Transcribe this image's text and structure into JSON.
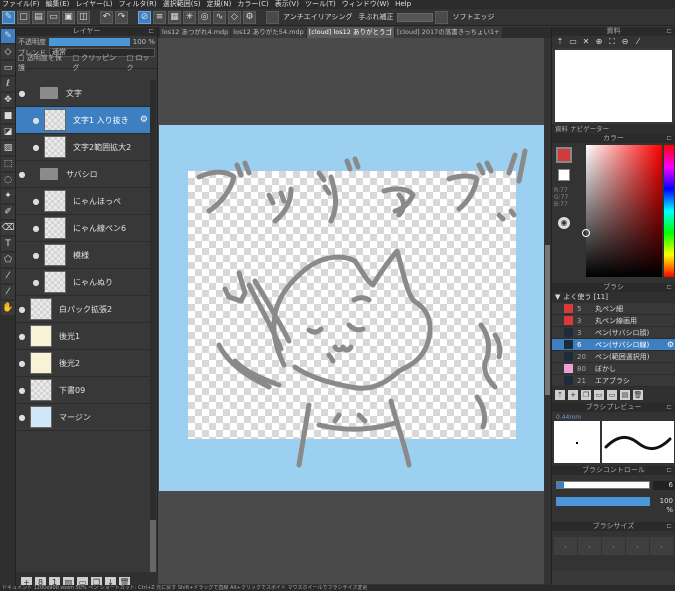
{
  "menu": [
    "ファイル(F)",
    "編集(E)",
    "レイヤー(L)",
    "フィルタ(R)",
    "選択範囲(S)",
    "定規(N)",
    "カラー(C)",
    "表示(V)",
    "ツール(T)",
    "ウィンドウ(W)",
    "Help"
  ],
  "toolbar": {
    "antialias_label": "アンチエイリアシング",
    "stabilizer_label": "手ぶれ補正",
    "soft_edge_label": "ソフトエッジ"
  },
  "layer_panel": {
    "title": "レイヤー",
    "opacity_label": "不透明度",
    "opacity_value": "100 %",
    "opacity_fraction": 1.0,
    "blend_label": "ブレンド",
    "blend_value": "通常",
    "protect_alpha_label": "透明度を保護",
    "clipping_label": "クリッピング",
    "lock_label": "ロック",
    "layers": [
      {
        "name": "文字",
        "type": "folder",
        "indent": false,
        "selected": false
      },
      {
        "name": "文字1 入り抜き",
        "type": "layer",
        "indent": true,
        "selected": true
      },
      {
        "name": "文字2範囲拡大2",
        "type": "layer",
        "indent": true,
        "selected": false
      },
      {
        "name": "サバシロ",
        "type": "folder",
        "indent": false,
        "selected": false
      },
      {
        "name": "にゃんほっぺ",
        "type": "layer",
        "indent": true,
        "selected": false
      },
      {
        "name": "にゃん線ペン6",
        "type": "layer",
        "indent": true,
        "selected": false
      },
      {
        "name": "模様",
        "type": "layer",
        "indent": true,
        "selected": false
      },
      {
        "name": "にゃんぬり",
        "type": "layer",
        "indent": true,
        "selected": false
      },
      {
        "name": "白パック拡張2",
        "type": "layer",
        "indent": false,
        "selected": false
      },
      {
        "name": "後光1",
        "type": "layer",
        "indent": false,
        "selected": false
      },
      {
        "name": "後光2",
        "type": "layer",
        "indent": false,
        "selected": false
      },
      {
        "name": "下書09",
        "type": "layer",
        "indent": false,
        "selected": false
      },
      {
        "name": "マージン",
        "type": "layer",
        "indent": false,
        "selected": false
      }
    ]
  },
  "tabs": [
    {
      "label": "los12 あつがれ4.mdp",
      "active": false
    },
    {
      "label": "los12 ありがた54.mdp",
      "active": false
    },
    {
      "label": "[cloud] los12 ありがとうゴ",
      "active": true
    },
    {
      "label": "[cloud] 2017の落書きっちょい1+",
      "active": false
    }
  ],
  "materials": {
    "title": "資料",
    "navigator_tab": "資料  ナビゲーター"
  },
  "color": {
    "title": "カラー",
    "main": "#d03b3b",
    "sub": "#ffffff",
    "readout": [
      "R:77",
      "G:77",
      "B:77"
    ]
  },
  "brush": {
    "title": "ブラシ",
    "group": "よく使う [11]",
    "items": [
      {
        "size": "5",
        "name": "丸ペン細",
        "color": "#d83a3a",
        "selected": false
      },
      {
        "size": "3",
        "name": "丸ペン線画用",
        "color": "#d83a3a",
        "selected": false
      },
      {
        "size": "3",
        "name": "ペン(サバシロ顔)",
        "color": "#1c2a3a",
        "selected": false
      },
      {
        "size": "6",
        "name": "ペン(サバシロ線)",
        "color": "#1c2a3a",
        "selected": true
      },
      {
        "size": "20",
        "name": "ペン(範囲選択用)",
        "color": "#1c2a3a",
        "selected": false
      },
      {
        "size": "80",
        "name": "ぼかし",
        "color": "#f0a0d0",
        "selected": false
      },
      {
        "size": "21",
        "name": "エアブラシ",
        "color": "#1c2a3a",
        "selected": false
      }
    ]
  },
  "brush_preview": {
    "title": "ブラシプレビュー",
    "size_label": "0.44mm"
  },
  "brush_control": {
    "title": "ブラシコントロール",
    "size_value": "6",
    "size_fraction": 0.08,
    "opacity_value": "100 %"
  },
  "brush_size": {
    "title": "ブラシサイズ",
    "cells": [
      ",",
      ",",
      ",",
      ",",
      ","
    ]
  },
  "status": "ドキュメント 1200x900  zoom 50%  ペン  ショートカット: Ctrl+Z 元に戻す  Shift+ドラッグで直線  Alt+クリックでスポイト  マウスホイールでブラシサイズ変更"
}
